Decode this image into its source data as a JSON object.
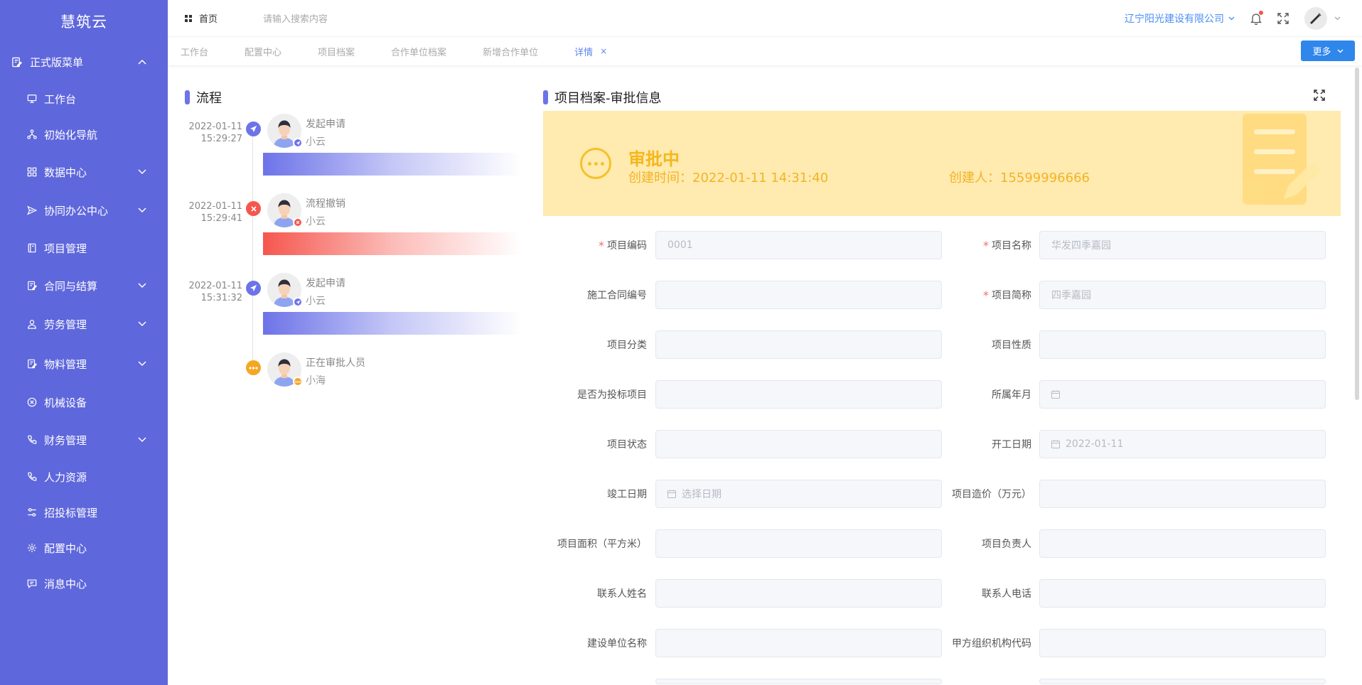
{
  "app": {
    "name": "慧筑云"
  },
  "sidebar": {
    "group_label": "正式版菜单",
    "items": [
      {
        "label": "工作台",
        "icon": "monitor-icon",
        "expandable": false
      },
      {
        "label": "初始化导航",
        "icon": "nodes-icon",
        "expandable": false
      },
      {
        "label": "数据中心",
        "icon": "grid-icon",
        "expandable": true
      },
      {
        "label": "协同办公中心",
        "icon": "send-icon",
        "expandable": true
      },
      {
        "label": "项目管理",
        "icon": "book-icon",
        "expandable": false
      },
      {
        "label": "合同与结算",
        "icon": "document-edit-icon",
        "expandable": true
      },
      {
        "label": "劳务管理",
        "icon": "worker-icon",
        "expandable": true
      },
      {
        "label": "物料管理",
        "icon": "document-edit-icon",
        "expandable": true
      },
      {
        "label": "机械设备",
        "icon": "circle-x-icon",
        "expandable": false
      },
      {
        "label": "财务管理",
        "icon": "phone-icon",
        "expandable": true
      },
      {
        "label": "人力资源",
        "icon": "phone-icon",
        "expandable": false
      },
      {
        "label": "招投标管理",
        "icon": "sliders-icon",
        "expandable": false
      },
      {
        "label": "配置中心",
        "icon": "gear-icon",
        "expandable": false
      },
      {
        "label": "消息中心",
        "icon": "message-icon",
        "expandable": false
      }
    ]
  },
  "header": {
    "home_label": "首页",
    "search_placeholder": "请输入搜索内容",
    "company": "辽宁阳光建设有限公司"
  },
  "tabs": {
    "items": [
      "工作台",
      "配置中心",
      "项目档案",
      "合作单位档案",
      "新增合作单位",
      "详情"
    ],
    "active_index": 5,
    "more_label": "更多"
  },
  "flow": {
    "title": "流程",
    "entries": [
      {
        "date": "2022-01-11",
        "time": "15:29:27",
        "action": "发起申请",
        "user": "小云",
        "status": "submitted",
        "color": "#6d73e8"
      },
      {
        "date": "2022-01-11",
        "time": "15:29:41",
        "action": "流程撤销",
        "user": "小云",
        "status": "revoked",
        "color": "#f5574e"
      },
      {
        "date": "2022-01-11",
        "time": "15:31:32",
        "action": "发起申请",
        "user": "小云",
        "status": "submitted",
        "color": "#6d73e8"
      },
      {
        "date": "",
        "time": "",
        "action": "正在审批人员",
        "user": "小海",
        "status": "pending",
        "color": "#f5a623"
      }
    ]
  },
  "approval": {
    "title": "项目档案-审批信息",
    "status": "审批中",
    "created_time": "创建时间：2022-01-11 14:31:40",
    "creator": "创建人：15599996666"
  },
  "form": {
    "left": [
      {
        "label": "项目编码",
        "required": true,
        "value": "0001",
        "date": false
      },
      {
        "label": "施工合同编号",
        "required": false,
        "value": "",
        "date": false
      },
      {
        "label": "项目分类",
        "required": false,
        "value": "",
        "date": false
      },
      {
        "label": "是否为投标项目",
        "required": false,
        "value": "",
        "date": false
      },
      {
        "label": "项目状态",
        "required": false,
        "value": "",
        "date": false
      },
      {
        "label": "竣工日期",
        "required": false,
        "value": "",
        "placeholder": "选择日期",
        "date": true
      },
      {
        "label": "项目面积（平方米）",
        "required": false,
        "value": "",
        "date": false
      },
      {
        "label": "联系人姓名",
        "required": false,
        "value": "",
        "date": false
      },
      {
        "label": "建设单位名称",
        "required": false,
        "value": "",
        "date": false
      }
    ],
    "right": [
      {
        "label": "项目名称",
        "required": true,
        "value": "华发四季嘉园",
        "date": false
      },
      {
        "label": "项目简称",
        "required": true,
        "value": "四季嘉园",
        "date": false
      },
      {
        "label": "项目性质",
        "required": false,
        "value": "",
        "date": false
      },
      {
        "label": "所属年月",
        "required": false,
        "value": "",
        "date": true
      },
      {
        "label": "开工日期",
        "required": false,
        "value": "2022-01-11",
        "date": true
      },
      {
        "label": "项目造价（万元）",
        "required": false,
        "value": "",
        "date": false
      },
      {
        "label": "项目负责人",
        "required": false,
        "value": "",
        "date": false
      },
      {
        "label": "联系人电话",
        "required": false,
        "value": "",
        "date": false
      },
      {
        "label": "甲方组织机构代码",
        "required": false,
        "value": "",
        "date": false
      }
    ]
  }
}
